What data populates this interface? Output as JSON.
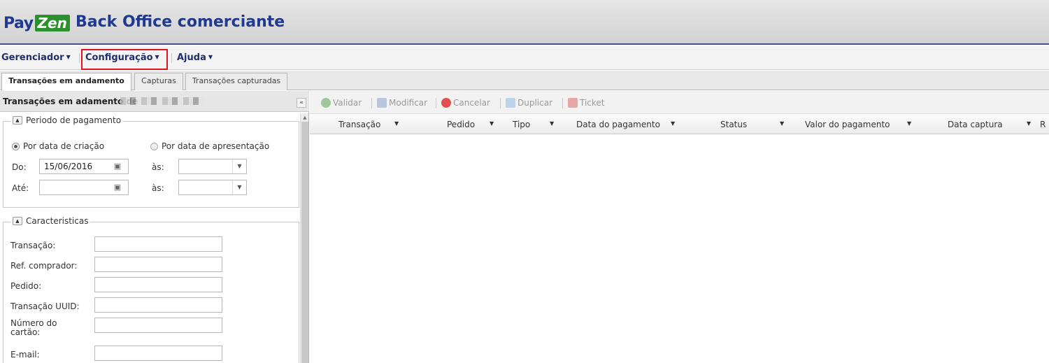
{
  "header": {
    "logo_pay": "Pay",
    "logo_zen": "Zen",
    "title": "Back Office comerciante"
  },
  "menu": {
    "items": [
      {
        "label": "Gerenciador"
      },
      {
        "label": "Configuração"
      },
      {
        "label": "Ajuda"
      }
    ],
    "highlighted": "Configuração",
    "highlight_color": "#e0141e"
  },
  "tabs": [
    {
      "label": "Transações em andamento",
      "active": true
    },
    {
      "label": "Capturas",
      "active": false
    },
    {
      "label": "Transações capturadas",
      "active": false
    }
  ],
  "left_panel": {
    "title": "Transações em adamento de",
    "periodo": {
      "legend": "Periodo de pagamento",
      "radio_criacao": "Por data de criação",
      "radio_apresentacao": "Por data de apresentação",
      "selected": "Por data de criação",
      "do_label": "Do:",
      "do_value": "15/06/2016",
      "ate_label": "Até:",
      "ate_value": "",
      "as_label": "às:"
    },
    "caracteristicas": {
      "legend": "Caracteristicas",
      "fields": [
        {
          "label": "Transação:",
          "value": ""
        },
        {
          "label": "Ref. comprador:",
          "value": ""
        },
        {
          "label": "Pedido:",
          "value": ""
        },
        {
          "label": "Transação UUID:",
          "value": ""
        },
        {
          "label": "Número do cartão:",
          "value": ""
        },
        {
          "label": "E-mail:",
          "value": ""
        }
      ]
    }
  },
  "toolbar": {
    "validar": "Validar",
    "modificar": "Modificar",
    "cancelar": "Cancelar",
    "duplicar": "Duplicar",
    "ticket": "Ticket"
  },
  "grid": {
    "columns": [
      "Transação",
      "Pedido",
      "Tipo",
      "Data do pagamento",
      "Status",
      "Valor do pagamento",
      "Data captura",
      "R"
    ]
  },
  "colors": {
    "brand_blue": "#1f3a8f",
    "brand_green": "#2d8f2d",
    "header_border": "#4a4a86"
  }
}
